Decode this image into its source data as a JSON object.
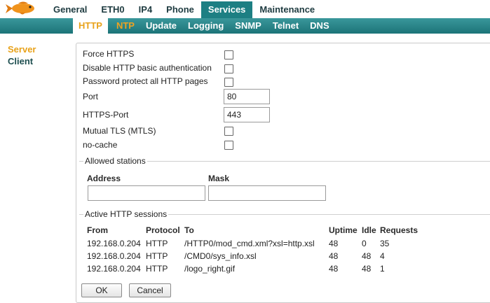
{
  "top_nav": [
    "General",
    "ETH0",
    "IP4",
    "Phone",
    "Services",
    "Maintenance"
  ],
  "top_nav_active": "Services",
  "sub_nav": [
    "HTTP",
    "NTP",
    "Update",
    "Logging",
    "SNMP",
    "Telnet",
    "DNS"
  ],
  "sub_nav_active": "HTTP",
  "left_nav": [
    "Server",
    "Client"
  ],
  "left_nav_active": "Server",
  "form": {
    "force_https": "Force HTTPS",
    "disable_basic_auth": "Disable HTTP basic authentication",
    "password_protect": "Password protect all HTTP pages",
    "port_label": "Port",
    "port_value": "80",
    "https_port_label": "HTTPS-Port",
    "https_port_value": "443",
    "mtls": "Mutual TLS (MTLS)",
    "no_cache": "no-cache"
  },
  "allowed_stations": {
    "legend": "Allowed stations",
    "address_header": "Address",
    "mask_header": "Mask",
    "address_value": "",
    "mask_value": ""
  },
  "sessions": {
    "legend": "Active HTTP sessions",
    "headers": {
      "from": "From",
      "protocol": "Protocol",
      "to": "To",
      "uptime": "Uptime",
      "idle": "Idle",
      "requests": "Requests"
    },
    "rows": [
      {
        "from": "192.168.0.204",
        "protocol": "HTTP",
        "to": "/HTTP0/mod_cmd.xml?xsl=http.xsl",
        "uptime": "48",
        "idle": "0",
        "requests": "35"
      },
      {
        "from": "192.168.0.204",
        "protocol": "HTTP",
        "to": "/CMD0/sys_info.xsl",
        "uptime": "48",
        "idle": "48",
        "requests": "4"
      },
      {
        "from": "192.168.0.204",
        "protocol": "HTTP",
        "to": "/logo_right.gif",
        "uptime": "48",
        "idle": "48",
        "requests": "1"
      }
    ]
  },
  "buttons": {
    "ok": "OK",
    "cancel": "Cancel"
  },
  "colors": {
    "teal": "#1d7f83",
    "accent": "#e8a21a",
    "text": "#1e3b40"
  }
}
